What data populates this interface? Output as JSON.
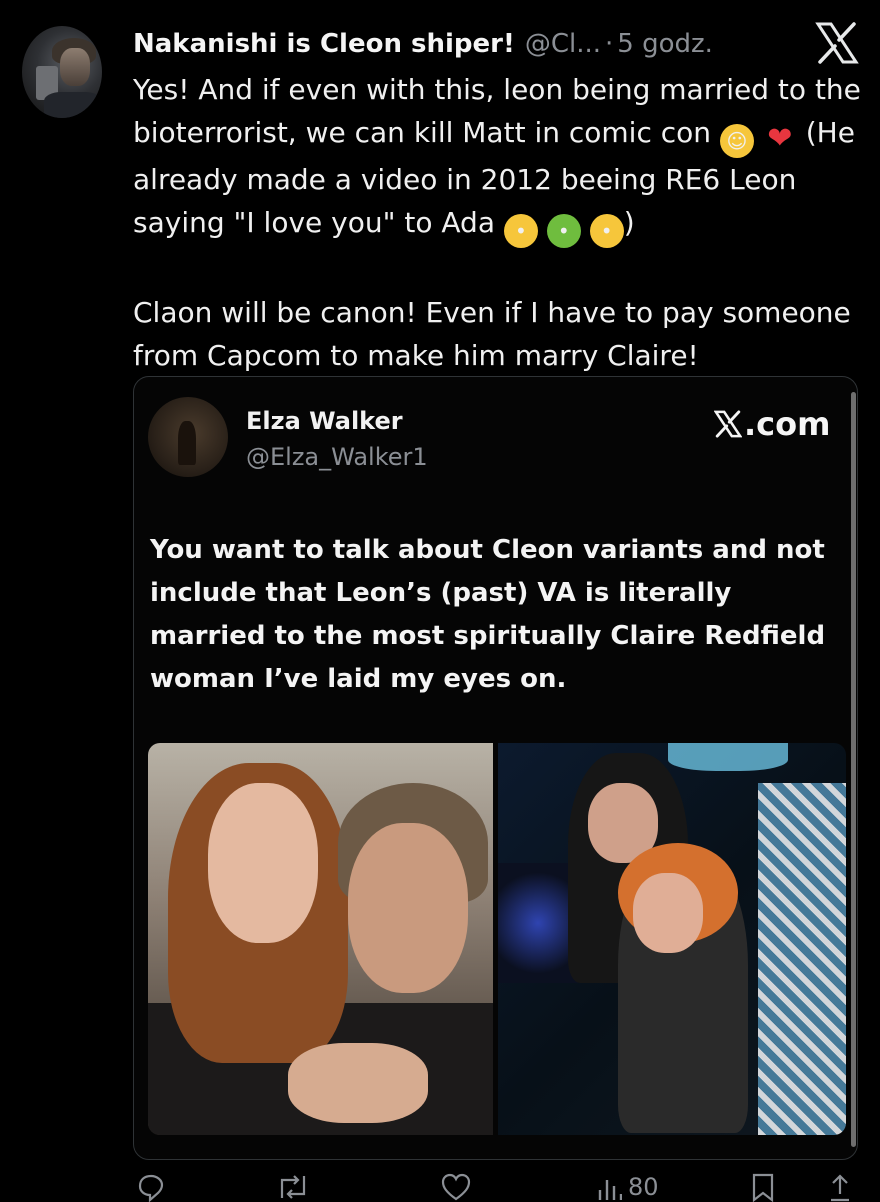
{
  "tweet": {
    "author_name": "Nakanishi is Cleon shiper!",
    "author_handle": "@Cl...",
    "separator": "·",
    "time": "5 godz.",
    "paragraph1_a": "Yes! And if even with this, leon being married to the bioterrorist, we can kill Matt in comic con ",
    "paragraph1_b": " (He already made a video in 2012 beeing RE6 Leon saying \"I love you\" to Ada ",
    "paragraph1_c": ")",
    "paragraph2": "Claon will be canon! Even if I have to pay someone from Capcom to make him marry Claire!"
  },
  "quote": {
    "name": "Elza Walker",
    "handle": "@Elza_Walker1",
    "site_label": ".com",
    "body": "You want to talk about Cleon variants and not include that Leon’s (past) VA is literally married to the most spiritually Claire Redfield woman I’ve laid my eyes on."
  },
  "actions": {
    "views_count": "80"
  },
  "icons": [
    "x-logo-icon",
    "smiling-face-emoji",
    "red-heart-emoji",
    "face-with-rolling-eyes-emoji",
    "nauseated-face-emoji",
    "face-vomiting-emoji",
    "reply-icon",
    "retweet-icon",
    "like-icon",
    "views-icon",
    "bookmark-icon",
    "share-icon"
  ],
  "colors": {
    "background": "#000000",
    "text": "#e7e9ea",
    "muted": "#8b8f95",
    "border": "#2f3336"
  }
}
